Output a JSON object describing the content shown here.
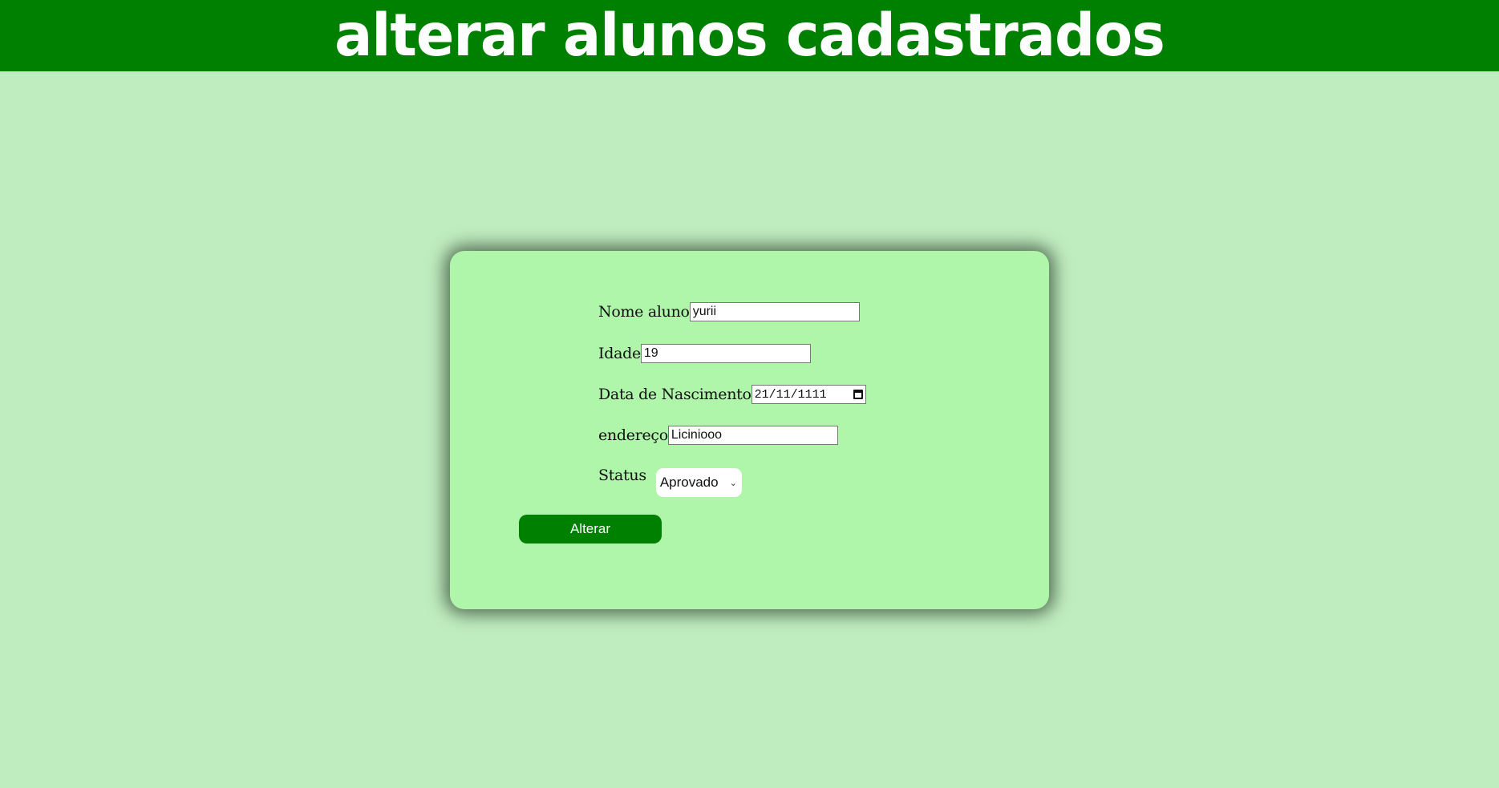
{
  "header": {
    "title": "alterar alunos cadastrados"
  },
  "form": {
    "nome": {
      "label": "Nome aluno",
      "value": "yurii"
    },
    "idade": {
      "label": "Idade",
      "value": "19"
    },
    "nascimento": {
      "label": "Data de Nascimento",
      "value": "21/11/1111"
    },
    "endereco": {
      "label": "endereço",
      "value": "Liciniooo"
    },
    "status": {
      "label": "Status",
      "selected": "Aprovado"
    },
    "submit_label": "Alterar"
  },
  "colors": {
    "header_bg": "#008000",
    "page_bg": "#c0edc0",
    "card_bg": "#aff5aa",
    "button_bg": "#008000"
  },
  "icons": {
    "date_picker": "calendar-icon",
    "select": "chevron-down-icon"
  }
}
